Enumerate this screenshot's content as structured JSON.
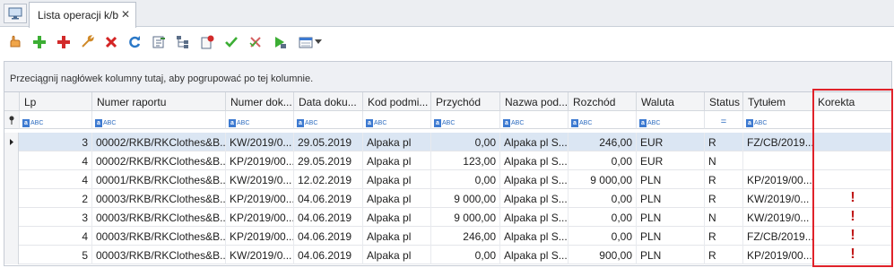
{
  "tab": {
    "label": "Lista operacji k/b",
    "close": "✕"
  },
  "group_panel": {
    "text": "Przeciągnij nagłówek kolumny tutaj, aby pogrupować po tej kolumnie."
  },
  "columns": [
    "Lp",
    "Numer raportu",
    "Numer dok...",
    "Data doku...",
    "Kod podmi...",
    "Przychód",
    "Nazwa pod...",
    "Rozchód",
    "Waluta",
    "Status",
    "Tytułem",
    "Korekta"
  ],
  "filter_abc": "ABC",
  "filter_eq": "=",
  "rows": [
    {
      "lp": "3",
      "raport": "00002/RKB/RKClothes&B...",
      "dok": "KW/2019/0...",
      "data": "29.05.2019",
      "kod": "Alpaka pl",
      "przychod": "0,00",
      "nazwa": "Alpaka pl S...",
      "rozchod": "246,00",
      "waluta": "EUR",
      "status": "R",
      "tytulem": "FZ/CB/2019...",
      "korekta": ""
    },
    {
      "lp": "4",
      "raport": "00002/RKB/RKClothes&B...",
      "dok": "KP/2019/00...",
      "data": "29.05.2019",
      "kod": "Alpaka pl",
      "przychod": "123,00",
      "nazwa": "Alpaka pl S...",
      "rozchod": "0,00",
      "waluta": "EUR",
      "status": "N",
      "tytulem": "",
      "korekta": ""
    },
    {
      "lp": "4",
      "raport": "00001/RKB/RKClothes&B...",
      "dok": "KW/2019/0...",
      "data": "12.02.2019",
      "kod": "Alpaka pl",
      "przychod": "0,00",
      "nazwa": "Alpaka pl S...",
      "rozchod": "9 000,00",
      "waluta": "PLN",
      "status": "R",
      "tytulem": "KP/2019/00...",
      "korekta": ""
    },
    {
      "lp": "2",
      "raport": "00003/RKB/RKClothes&B...",
      "dok": "KP/2019/00...",
      "data": "04.06.2019",
      "kod": "Alpaka pl",
      "przychod": "9 000,00",
      "nazwa": "Alpaka pl S...",
      "rozchod": "0,00",
      "waluta": "PLN",
      "status": "R",
      "tytulem": "KW/2019/0...",
      "korekta": "!"
    },
    {
      "lp": "3",
      "raport": "00003/RKB/RKClothes&B...",
      "dok": "KP/2019/00...",
      "data": "04.06.2019",
      "kod": "Alpaka pl",
      "przychod": "9 000,00",
      "nazwa": "Alpaka pl S...",
      "rozchod": "0,00",
      "waluta": "PLN",
      "status": "N",
      "tytulem": "KW/2019/0...",
      "korekta": "!"
    },
    {
      "lp": "4",
      "raport": "00003/RKB/RKClothes&B...",
      "dok": "KP/2019/00...",
      "data": "04.06.2019",
      "kod": "Alpaka pl",
      "przychod": "246,00",
      "nazwa": "Alpaka pl S...",
      "rozchod": "0,00",
      "waluta": "PLN",
      "status": "R",
      "tytulem": "FZ/CB/2019...",
      "korekta": "!"
    },
    {
      "lp": "5",
      "raport": "00003/RKB/RKClothes&B...",
      "dok": "KW/2019/0...",
      "data": "04.06.2019",
      "kod": "Alpaka pl",
      "przychod": "0,00",
      "nazwa": "Alpaka pl S...",
      "rozchod": "900,00",
      "waluta": "PLN",
      "status": "R",
      "tytulem": "KP/2019/00...",
      "korekta": "!"
    }
  ]
}
